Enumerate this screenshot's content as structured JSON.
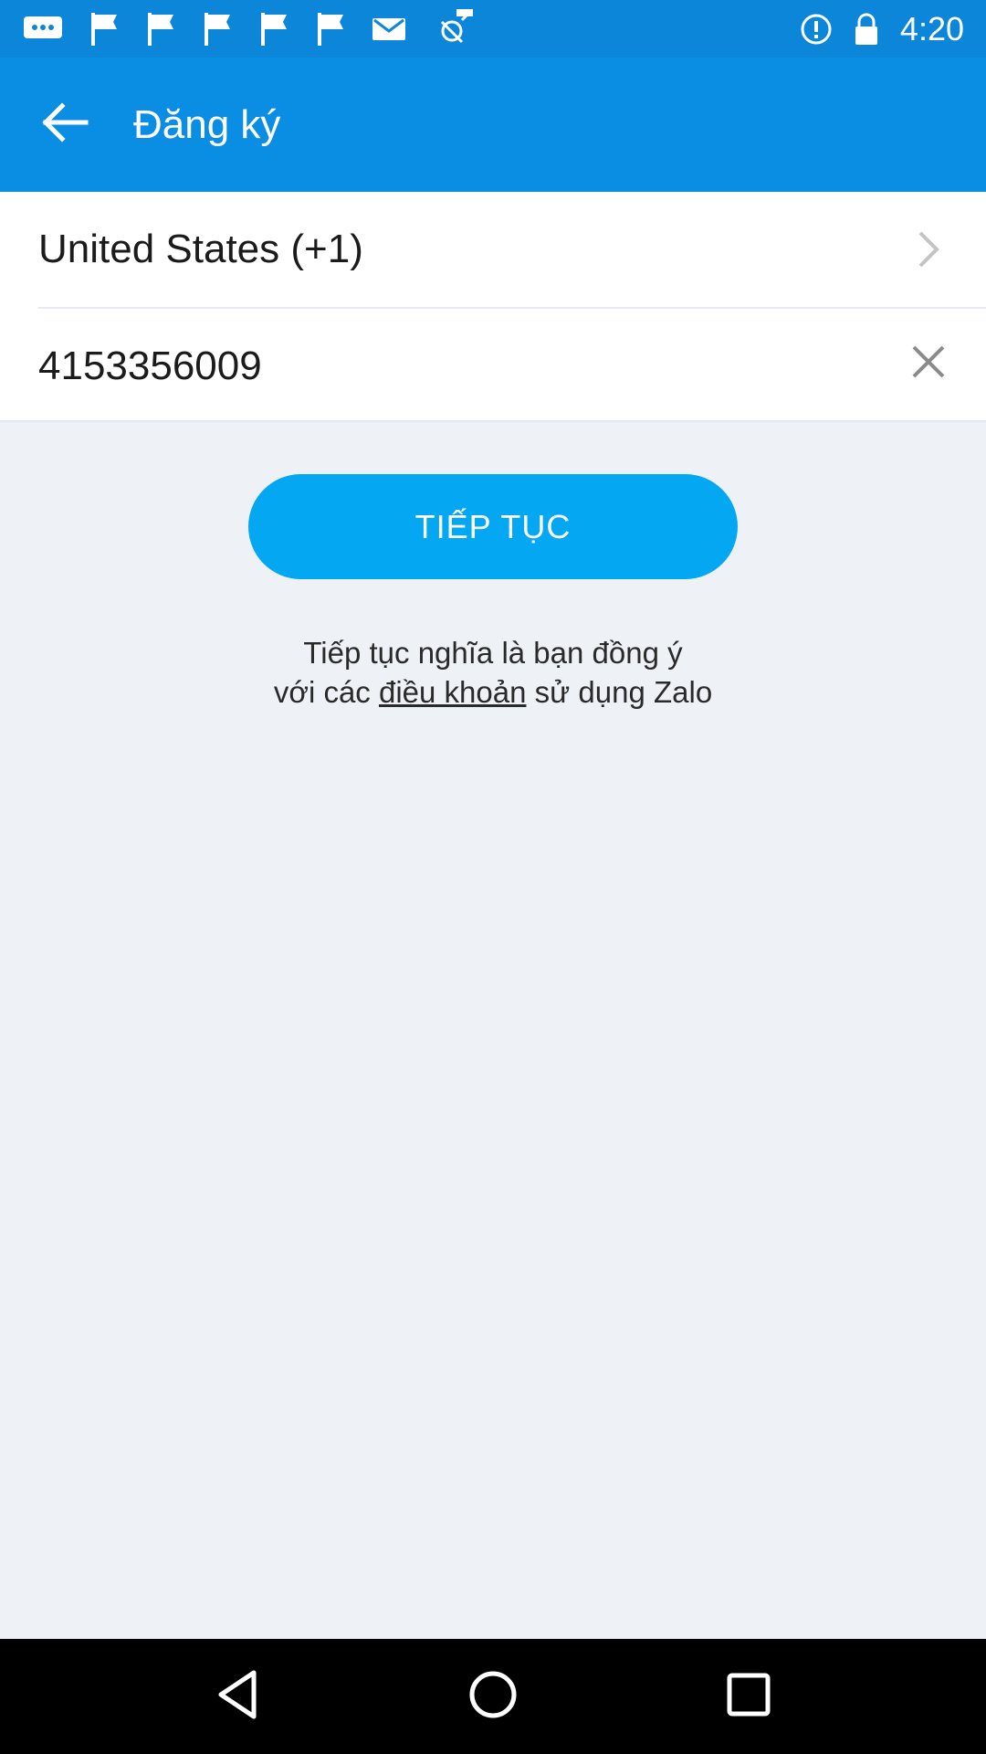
{
  "status_bar": {
    "time": "4:20",
    "icons_left": [
      "chat-bubble-icon",
      "flag-icon",
      "flag-icon",
      "flag-icon",
      "flag-icon",
      "flag-icon",
      "mail-icon",
      "fake-gps-icon"
    ],
    "icons_right": [
      "alert-circle-icon",
      "lock-icon"
    ]
  },
  "app_bar": {
    "title": "Đăng ký",
    "back_icon": "arrow-left-icon"
  },
  "form": {
    "country": "United States (+1)",
    "phone": "4153356009"
  },
  "actions": {
    "continue_label": "TIẾP TỤC"
  },
  "terms": {
    "line1": "Tiếp tục nghĩa là bạn đồng ý",
    "prefix": "với các ",
    "link": "điều khoản",
    "suffix": " sử dụng Zalo"
  },
  "nav_bar": {
    "icons": [
      "back-triangle-icon",
      "home-circle-icon",
      "recents-square-icon"
    ]
  },
  "colors": {
    "status_bar": "#0b86d9",
    "app_bar": "#0a8ee4",
    "button": "#03a7f2",
    "background": "#eef2f6"
  }
}
